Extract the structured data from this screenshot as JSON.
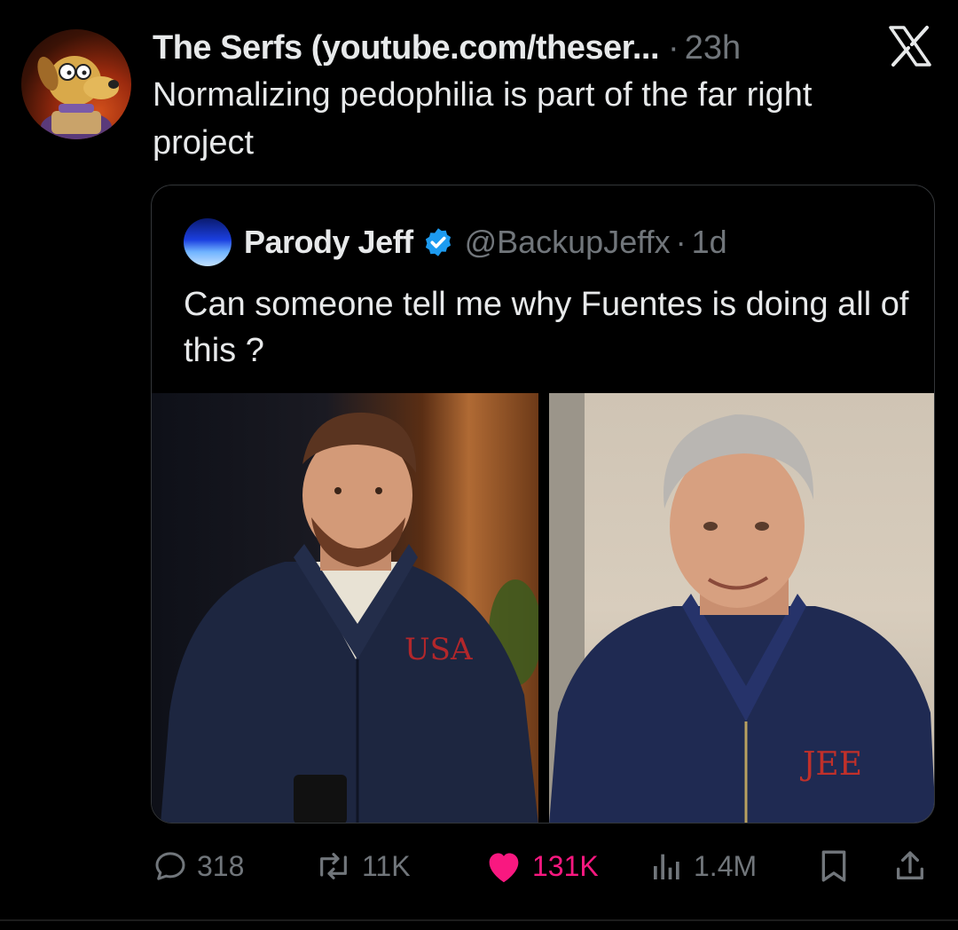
{
  "post": {
    "author": "The Serfs (youtube.com/theser...",
    "separator": "·",
    "time": "23h",
    "text": "Normalizing pedophilia is part of the far right project"
  },
  "quoted_post": {
    "name": "Parody Jeff",
    "handle": "@BackupJeffx",
    "separator": "·",
    "time": "1d",
    "text": "Can someone tell me why Fuentes is doing all of this ?",
    "images": [
      "photo-left",
      "photo-right"
    ]
  },
  "actions": {
    "replies": "318",
    "reposts": "11K",
    "likes": "131K",
    "views": "1.4M"
  },
  "colors": {
    "background": "#000000",
    "text": "#e7e9ea",
    "muted": "#71767b",
    "like": "#f91880",
    "verified": "#1d9bf0"
  },
  "icons": [
    "x-logo-icon",
    "verified-badge-icon",
    "reply-icon",
    "repost-icon",
    "like-icon",
    "views-icon",
    "bookmark-icon",
    "share-icon"
  ]
}
